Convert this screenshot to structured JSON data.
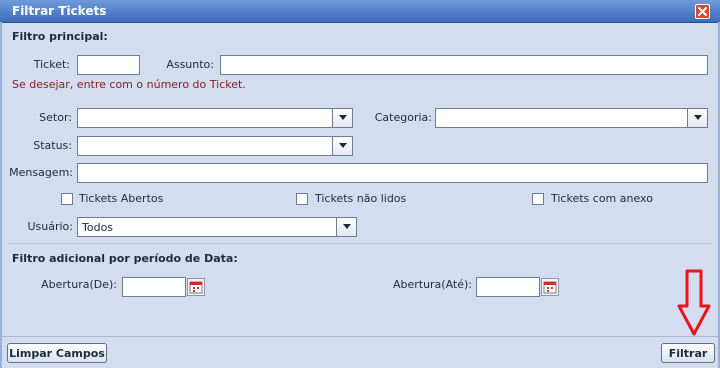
{
  "window": {
    "title": "Filtrar Tickets"
  },
  "main_filter": {
    "section_title": "Filtro principal:",
    "ticket_label": "Ticket:",
    "ticket_value": "",
    "subject_label": "Assunto:",
    "subject_value": "",
    "hint": "Se desejar, entre com o número do Ticket.",
    "sector_label": "Setor:",
    "sector_value": "",
    "category_label": "Categoria:",
    "category_value": "",
    "status_label": "Status:",
    "status_value": "",
    "message_label": "Mensagem:",
    "message_value": "",
    "checkboxes": [
      {
        "label": "Tickets Abertos",
        "checked": false
      },
      {
        "label": "Tickets não lidos",
        "checked": false
      },
      {
        "label": "Tickets com anexo",
        "checked": false
      }
    ],
    "user_label": "Usuário:",
    "user_value": "Todos"
  },
  "date_filter": {
    "section_title": "Filtro adicional por período de Data:",
    "from_label": "Abertura(De):",
    "from_value": "",
    "to_label": "Abertura(Até):",
    "to_value": ""
  },
  "footer": {
    "clear_label": "Limpar Campos",
    "filter_label": "Filtrar"
  },
  "colors": {
    "titlebar": "#3d6bb8",
    "background": "#d3ddef",
    "hint": "#8a1c1c",
    "annotation_arrow": "#e8141c"
  },
  "icons": {
    "close": "close-icon",
    "dropdown": "chevron-down-icon",
    "calendar": "calendar-icon",
    "annotation": "down-arrow-icon"
  }
}
